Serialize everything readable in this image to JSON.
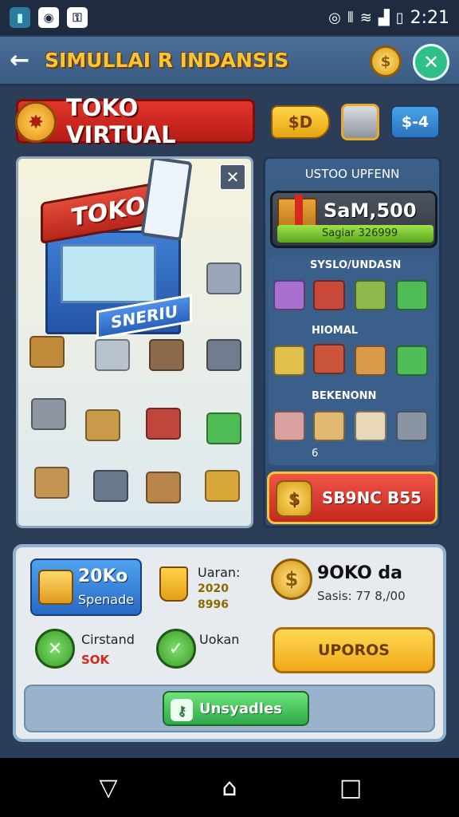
{
  "status_bar": {
    "time": "2:21",
    "icons": [
      "app-icon",
      "camera-icon",
      "vpn-icon",
      "eye-icon",
      "vibrate-icon",
      "wifi-icon",
      "signal-icon",
      "battery-icon"
    ]
  },
  "app_bar": {
    "title": "SIMULLAI R INDANSIS",
    "coin_symbol": "$",
    "close_symbol": "✕",
    "back_symbol": "←"
  },
  "shop_header": {
    "title": "TOKO VIRTUAL",
    "price_tag_gold": "$D",
    "price_tag_blue": "$-4"
  },
  "illustration": {
    "store_roof_text": "TOKO",
    "store_sign_text": "SNERIU",
    "close_symbol": "✕"
  },
  "right_panel": {
    "title": "USTOO UPFENN",
    "cash_value": "SaM,500 O",
    "cash_sub": "Sagiar 326999",
    "section1": "SYSLO/UNDASN",
    "section2": "HIOMAL",
    "section3": "BEKENONN",
    "small_number": "6",
    "red_button": "SB9NC B55"
  },
  "bottom_panel": {
    "blue_card_main": "20Ko",
    "blue_card_sub": "Spenade",
    "cup_label": "Uaran:",
    "cup_value1": "2020",
    "cup_value2": "8996",
    "coin_main": "9OKO da",
    "coin_sub": "Sasis: 77 8,/00",
    "left_round_label": "Cirstand",
    "left_round_value": "SOK",
    "right_round_label": "Uokan",
    "upgrade_button": "UPOROS",
    "green_button": "Unsyadles"
  },
  "colors": {
    "background": "#2b3d57",
    "accent_gold": "#f6c53a",
    "accent_red": "#e2352b",
    "accent_green": "#2fbf8a"
  }
}
